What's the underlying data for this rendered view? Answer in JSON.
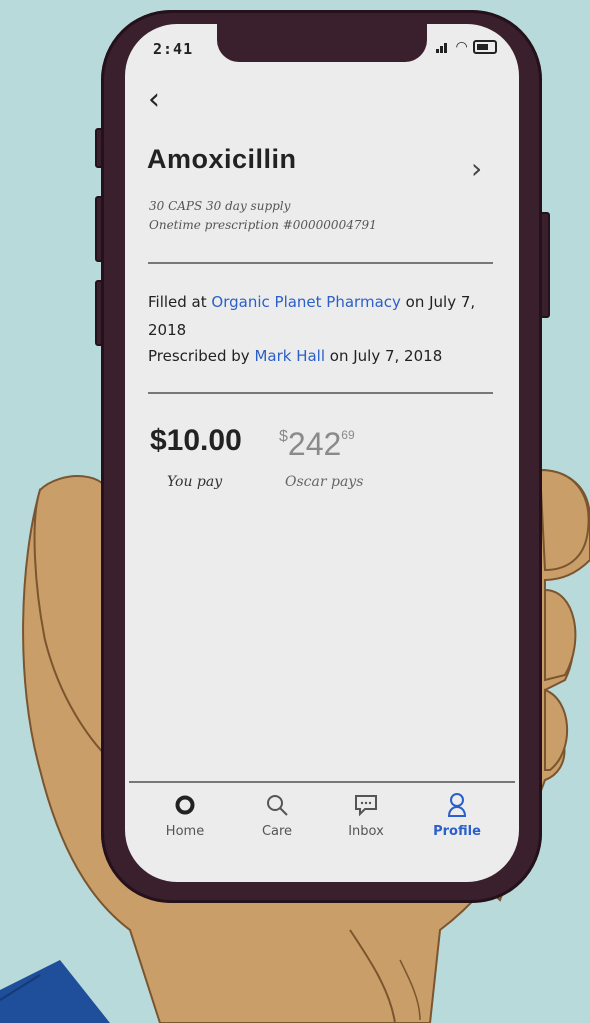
{
  "status_bar": {
    "time": "2:41",
    "icons": [
      "signal-icon",
      "wifi-icon",
      "battery-icon"
    ]
  },
  "nav": {
    "back_icon": "chevron-left-icon",
    "back_glyph": "‹"
  },
  "prescription": {
    "name": "Amoxicillin",
    "detail_line1": "30 CAPS 30 day supply",
    "detail_line2": "Onetime prescription #00000004791",
    "filled_prefix": "Filled at ",
    "pharmacy": "Organic Planet Pharmacy",
    "filled_suffix": " on July 7, 2018",
    "prescribed_prefix": "Prescribed by ",
    "prescriber": "Mark Hall",
    "prescribed_suffix": " on July 7, 2018"
  },
  "costs": {
    "you_pay": "$10.00",
    "you_pay_label": "You pay",
    "oscar_currency": "$",
    "oscar_dollars": "242",
    "oscar_cents": "69",
    "oscar_label": "Oscar pays"
  },
  "tabs": [
    {
      "label": "Home",
      "icon": "home-icon",
      "active": false
    },
    {
      "label": "Care",
      "icon": "search-icon",
      "active": false
    },
    {
      "label": "Inbox",
      "icon": "message-icon",
      "active": false
    },
    {
      "label": "Profile",
      "icon": "person-icon",
      "active": true
    }
  ],
  "colors": {
    "background": "#b9dada",
    "accent": "#2b5fc9",
    "phone_frame": "#3a1f2d",
    "screen": "#ececec",
    "skin": "#c99e68"
  }
}
